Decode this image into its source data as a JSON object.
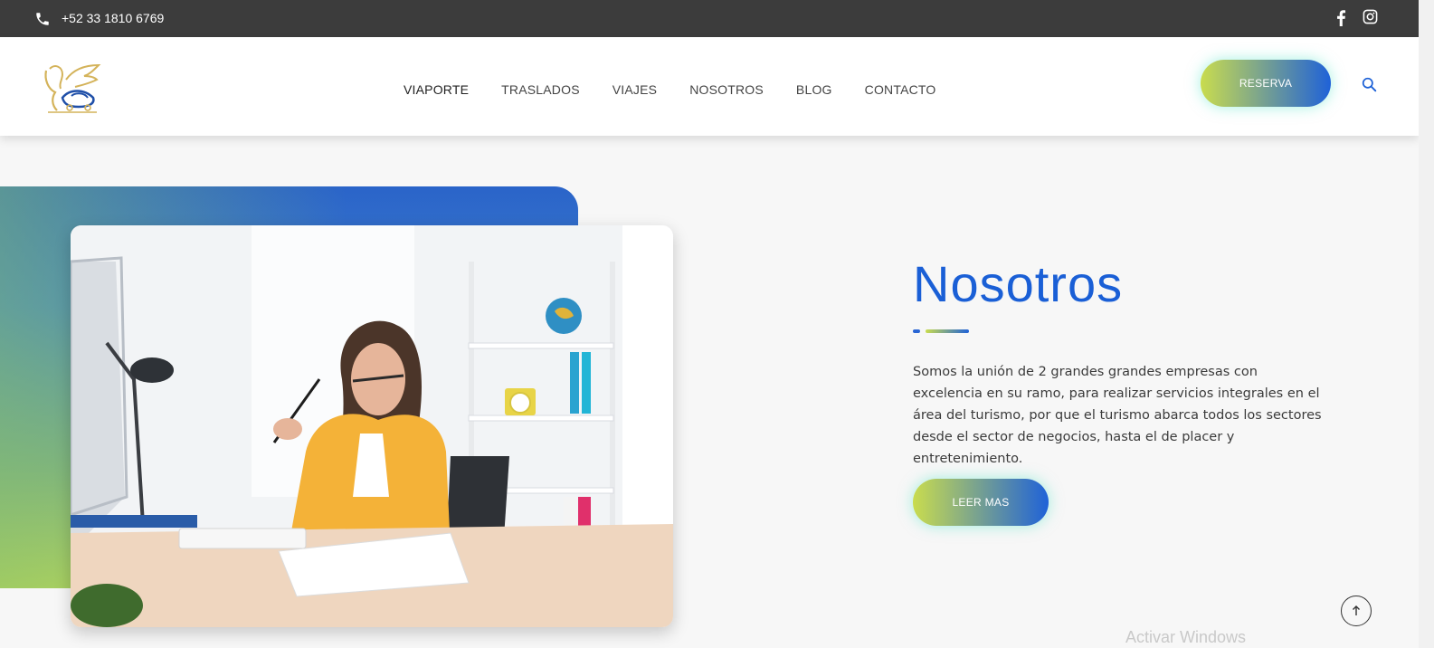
{
  "topbar": {
    "phone": "+52 33 1810 6769",
    "icons": [
      "phone-icon",
      "facebook-icon",
      "instagram-icon"
    ]
  },
  "header": {
    "nav": [
      "VIAPORTE",
      "TRASLADOS",
      "VIAJES",
      "NOSOTROS",
      "BLOG",
      "CONTACTO"
    ],
    "reserva_label": "RESERVA",
    "icons": [
      "logo",
      "search-icon"
    ]
  },
  "main": {
    "title": "Nosotros",
    "description": "Somos la unión de 2 grandes grandes empresas con excelencia en su ramo, para realizar servicios integrales en el área del turismo, por que el turismo abarca todos los sectores desde el sector de negocios, hasta el de placer y entretenimiento.",
    "button_label": "LEER MAS",
    "icons": [
      "arrow-up-icon"
    ]
  },
  "watermark": "Activar Windows",
  "colors": {
    "accent_blue": "#1a5fd6",
    "accent_green": "#c9dc4e",
    "topbar": "#3c3c3c"
  }
}
